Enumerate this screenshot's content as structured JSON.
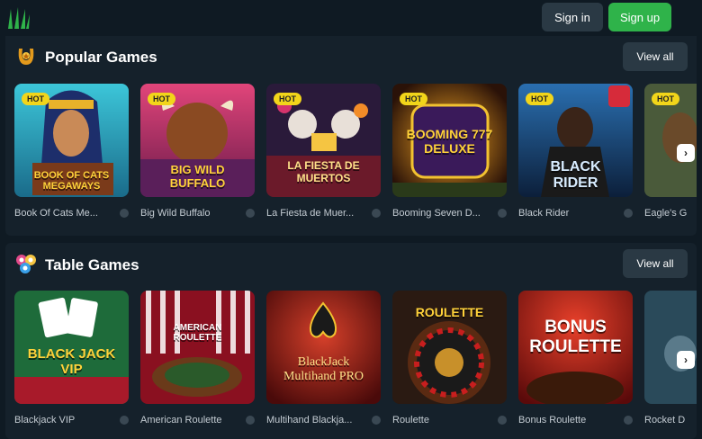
{
  "header": {
    "signin_label": "Sign in",
    "signup_label": "Sign up",
    "logo_icon": "claw-logo-icon"
  },
  "popular": {
    "title": "Popular Games",
    "view_all": "View all",
    "icon": "horseshoe-icon",
    "games": [
      {
        "name": "Book Of Cats Me...",
        "badge": "HOT",
        "art": "BOOK OF CATS MEGAWAYS"
      },
      {
        "name": "Big Wild Buffalo",
        "badge": "HOT",
        "art": "BIG WILD BUFFALO"
      },
      {
        "name": "La Fiesta de Muer...",
        "badge": "HOT",
        "art": "LA FIESTA DE MUERTOS"
      },
      {
        "name": "Booming Seven D...",
        "badge": "HOT",
        "art": "BOOMING 777 DELUXE"
      },
      {
        "name": "Black Rider",
        "badge": "HOT",
        "art": "BLACK RIDER"
      },
      {
        "name": "Eagle's G",
        "badge": "HOT",
        "art": ""
      }
    ]
  },
  "table": {
    "title": "Table Games",
    "view_all": "View all",
    "icon": "lottery-balls-icon",
    "games": [
      {
        "name": "Blackjack VIP",
        "art": "BLACK JACK VIP"
      },
      {
        "name": "American Roulette",
        "art": "AMERICAN ROULETTE"
      },
      {
        "name": "Multihand Blackja...",
        "art": "BlackJack Multihand PRO"
      },
      {
        "name": "Roulette",
        "art": "ROULETTE"
      },
      {
        "name": "Bonus Roulette",
        "art": "BONUS ROULETTE"
      },
      {
        "name": "Rocket D",
        "art": ""
      }
    ]
  },
  "colors": {
    "background": "#0f1a23",
    "panel": "#15212b",
    "signup": "#2fb34a",
    "hot_badge": "#f2d51a"
  }
}
